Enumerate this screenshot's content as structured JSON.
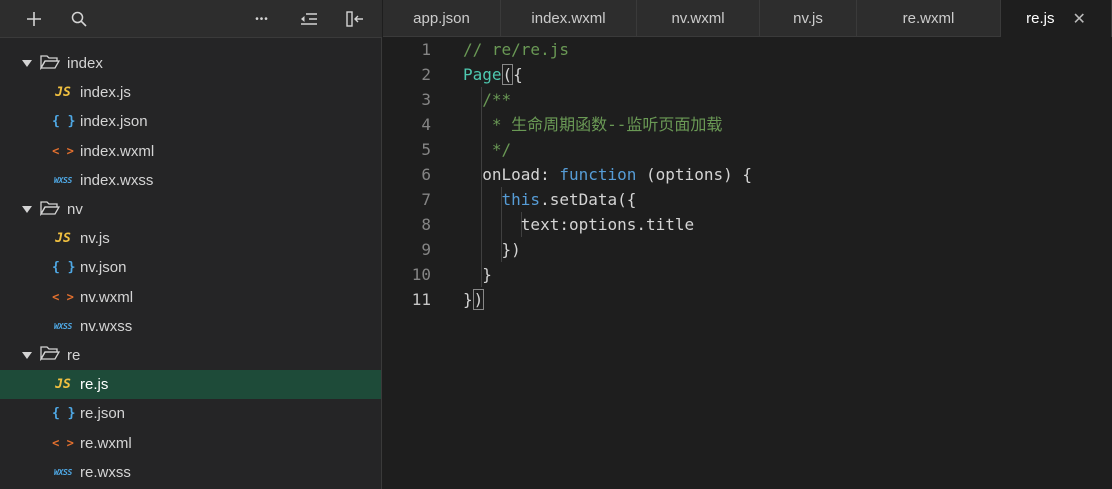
{
  "toolbar": {
    "icons": [
      "plus-icon",
      "search-icon",
      "more-icon",
      "collapse-icon",
      "split-icon"
    ],
    "more_glyph": "•••"
  },
  "tree": {
    "folders": [
      {
        "name": "index",
        "files": [
          "index.js",
          "index.json",
          "index.wxml",
          "index.wxss"
        ]
      },
      {
        "name": "nv",
        "files": [
          "nv.js",
          "nv.json",
          "nv.wxml",
          "nv.wxss"
        ]
      },
      {
        "name": "re",
        "files": [
          "re.js",
          "re.json",
          "re.wxml",
          "re.wxss"
        ]
      }
    ],
    "selected": "re.js",
    "icon_text": {
      "js": "JS",
      "json": "{ }",
      "wxml": "< >",
      "wxss": "WXSS"
    },
    "colors": {
      "js": "#f0c040",
      "json": "#4fa9e6",
      "wxml": "#e4702e",
      "wxss": "#4fa9e6",
      "selected_bg": "#1e4b39"
    }
  },
  "tabs": {
    "items": [
      "app.json",
      "index.wxml",
      "nv.wxml",
      "nv.js",
      "re.wxml",
      "re.js"
    ],
    "active": "re.js",
    "close_glyph": "✕"
  },
  "editor": {
    "current_line": 11,
    "lines": [
      {
        "n": "1",
        "tokens": [
          [
            "c-com",
            "// re/re.js"
          ]
        ]
      },
      {
        "n": "2",
        "tokens": [
          [
            "c-fn",
            "Page"
          ],
          [
            "c-def bracket-box",
            "("
          ],
          [
            "c-def",
            "{"
          ]
        ]
      },
      {
        "n": "3",
        "tokens": [
          [
            "c-com",
            "  /**"
          ]
        ]
      },
      {
        "n": "4",
        "tokens": [
          [
            "c-com",
            "   * 生命周期函数--监听页面加载"
          ]
        ]
      },
      {
        "n": "5",
        "tokens": [
          [
            "c-com",
            "   */"
          ]
        ]
      },
      {
        "n": "6",
        "tokens": [
          [
            "c-def",
            "  onLoad: "
          ],
          [
            "c-kw",
            "function"
          ],
          [
            "c-def",
            " (options) {"
          ]
        ]
      },
      {
        "n": "7",
        "tokens": [
          [
            "c-def",
            "    "
          ],
          [
            "c-kw",
            "this"
          ],
          [
            "c-def",
            ".setData({"
          ]
        ]
      },
      {
        "n": "8",
        "tokens": [
          [
            "c-def",
            "      text:options.title"
          ]
        ]
      },
      {
        "n": "9",
        "tokens": [
          [
            "c-def",
            "    })"
          ]
        ]
      },
      {
        "n": "10",
        "tokens": [
          [
            "c-def",
            "  }"
          ]
        ]
      },
      {
        "n": "11",
        "tokens": [
          [
            "c-def",
            "}"
          ],
          [
            "c-def bracket-box",
            ")"
          ]
        ]
      }
    ]
  }
}
